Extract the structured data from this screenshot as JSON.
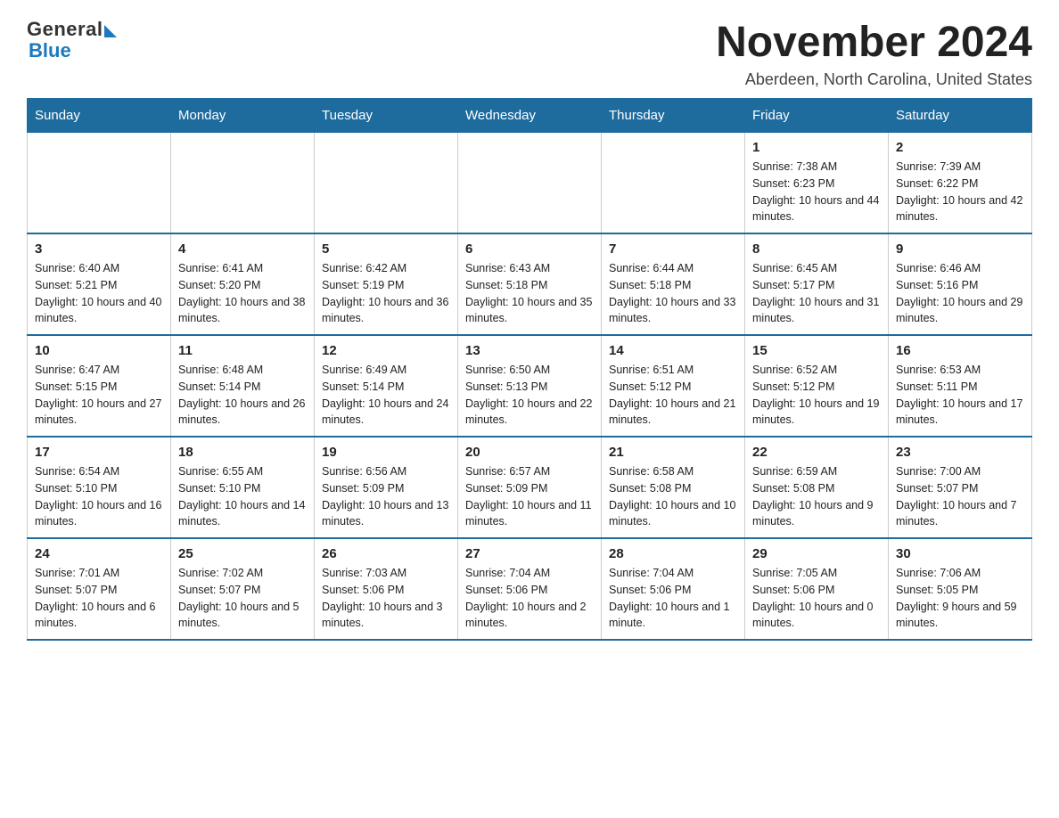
{
  "logo": {
    "general": "General",
    "blue": "Blue"
  },
  "title": "November 2024",
  "location": "Aberdeen, North Carolina, United States",
  "days_of_week": [
    "Sunday",
    "Monday",
    "Tuesday",
    "Wednesday",
    "Thursday",
    "Friday",
    "Saturday"
  ],
  "weeks": [
    [
      {
        "day": "",
        "info": ""
      },
      {
        "day": "",
        "info": ""
      },
      {
        "day": "",
        "info": ""
      },
      {
        "day": "",
        "info": ""
      },
      {
        "day": "",
        "info": ""
      },
      {
        "day": "1",
        "info": "Sunrise: 7:38 AM\nSunset: 6:23 PM\nDaylight: 10 hours and 44 minutes."
      },
      {
        "day": "2",
        "info": "Sunrise: 7:39 AM\nSunset: 6:22 PM\nDaylight: 10 hours and 42 minutes."
      }
    ],
    [
      {
        "day": "3",
        "info": "Sunrise: 6:40 AM\nSunset: 5:21 PM\nDaylight: 10 hours and 40 minutes."
      },
      {
        "day": "4",
        "info": "Sunrise: 6:41 AM\nSunset: 5:20 PM\nDaylight: 10 hours and 38 minutes."
      },
      {
        "day": "5",
        "info": "Sunrise: 6:42 AM\nSunset: 5:19 PM\nDaylight: 10 hours and 36 minutes."
      },
      {
        "day": "6",
        "info": "Sunrise: 6:43 AM\nSunset: 5:18 PM\nDaylight: 10 hours and 35 minutes."
      },
      {
        "day": "7",
        "info": "Sunrise: 6:44 AM\nSunset: 5:18 PM\nDaylight: 10 hours and 33 minutes."
      },
      {
        "day": "8",
        "info": "Sunrise: 6:45 AM\nSunset: 5:17 PM\nDaylight: 10 hours and 31 minutes."
      },
      {
        "day": "9",
        "info": "Sunrise: 6:46 AM\nSunset: 5:16 PM\nDaylight: 10 hours and 29 minutes."
      }
    ],
    [
      {
        "day": "10",
        "info": "Sunrise: 6:47 AM\nSunset: 5:15 PM\nDaylight: 10 hours and 27 minutes."
      },
      {
        "day": "11",
        "info": "Sunrise: 6:48 AM\nSunset: 5:14 PM\nDaylight: 10 hours and 26 minutes."
      },
      {
        "day": "12",
        "info": "Sunrise: 6:49 AM\nSunset: 5:14 PM\nDaylight: 10 hours and 24 minutes."
      },
      {
        "day": "13",
        "info": "Sunrise: 6:50 AM\nSunset: 5:13 PM\nDaylight: 10 hours and 22 minutes."
      },
      {
        "day": "14",
        "info": "Sunrise: 6:51 AM\nSunset: 5:12 PM\nDaylight: 10 hours and 21 minutes."
      },
      {
        "day": "15",
        "info": "Sunrise: 6:52 AM\nSunset: 5:12 PM\nDaylight: 10 hours and 19 minutes."
      },
      {
        "day": "16",
        "info": "Sunrise: 6:53 AM\nSunset: 5:11 PM\nDaylight: 10 hours and 17 minutes."
      }
    ],
    [
      {
        "day": "17",
        "info": "Sunrise: 6:54 AM\nSunset: 5:10 PM\nDaylight: 10 hours and 16 minutes."
      },
      {
        "day": "18",
        "info": "Sunrise: 6:55 AM\nSunset: 5:10 PM\nDaylight: 10 hours and 14 minutes."
      },
      {
        "day": "19",
        "info": "Sunrise: 6:56 AM\nSunset: 5:09 PM\nDaylight: 10 hours and 13 minutes."
      },
      {
        "day": "20",
        "info": "Sunrise: 6:57 AM\nSunset: 5:09 PM\nDaylight: 10 hours and 11 minutes."
      },
      {
        "day": "21",
        "info": "Sunrise: 6:58 AM\nSunset: 5:08 PM\nDaylight: 10 hours and 10 minutes."
      },
      {
        "day": "22",
        "info": "Sunrise: 6:59 AM\nSunset: 5:08 PM\nDaylight: 10 hours and 9 minutes."
      },
      {
        "day": "23",
        "info": "Sunrise: 7:00 AM\nSunset: 5:07 PM\nDaylight: 10 hours and 7 minutes."
      }
    ],
    [
      {
        "day": "24",
        "info": "Sunrise: 7:01 AM\nSunset: 5:07 PM\nDaylight: 10 hours and 6 minutes."
      },
      {
        "day": "25",
        "info": "Sunrise: 7:02 AM\nSunset: 5:07 PM\nDaylight: 10 hours and 5 minutes."
      },
      {
        "day": "26",
        "info": "Sunrise: 7:03 AM\nSunset: 5:06 PM\nDaylight: 10 hours and 3 minutes."
      },
      {
        "day": "27",
        "info": "Sunrise: 7:04 AM\nSunset: 5:06 PM\nDaylight: 10 hours and 2 minutes."
      },
      {
        "day": "28",
        "info": "Sunrise: 7:04 AM\nSunset: 5:06 PM\nDaylight: 10 hours and 1 minute."
      },
      {
        "day": "29",
        "info": "Sunrise: 7:05 AM\nSunset: 5:06 PM\nDaylight: 10 hours and 0 minutes."
      },
      {
        "day": "30",
        "info": "Sunrise: 7:06 AM\nSunset: 5:05 PM\nDaylight: 9 hours and 59 minutes."
      }
    ]
  ]
}
